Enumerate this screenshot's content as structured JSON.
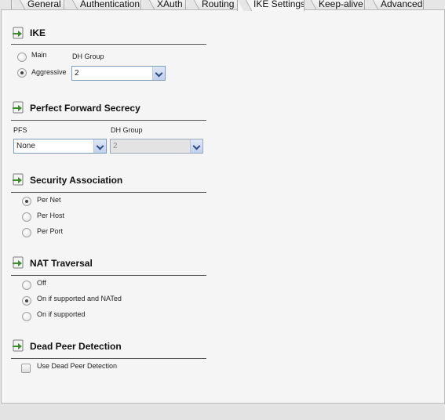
{
  "tabs": [
    "General",
    "Authentication",
    "XAuth",
    "Routing",
    "IKE Settings",
    "Keep-alive",
    "Advanced"
  ],
  "active_tab": "IKE Settings",
  "ike": {
    "title": "IKE",
    "main_label": "Main",
    "aggressive_label": "Aggressive",
    "dh_group_label": "DH Group",
    "dh_group_value": "2",
    "selected_mode": "Aggressive"
  },
  "pfs": {
    "title": "Perfect Forward Secrecy",
    "pfs_label": "PFS",
    "pfs_value": "None",
    "dh_group_label": "DH Group",
    "dh_group_value": "2",
    "dh_group_disabled": true
  },
  "sa": {
    "title": "Security Association",
    "options": [
      "Per Net",
      "Per Host",
      "Per Port"
    ],
    "selected": "Per Net"
  },
  "nat": {
    "title": "NAT Traversal",
    "options": [
      "Off",
      "On if supported and NATed",
      "On if supported"
    ],
    "selected": "On if supported and NATed"
  },
  "dpd": {
    "title": "Dead Peer Detection",
    "checkbox_label": "Use Dead Peer Detection",
    "checked": false
  },
  "colors": {
    "section_icon": "#3f8a2e",
    "select_border": "#7f9db9"
  }
}
